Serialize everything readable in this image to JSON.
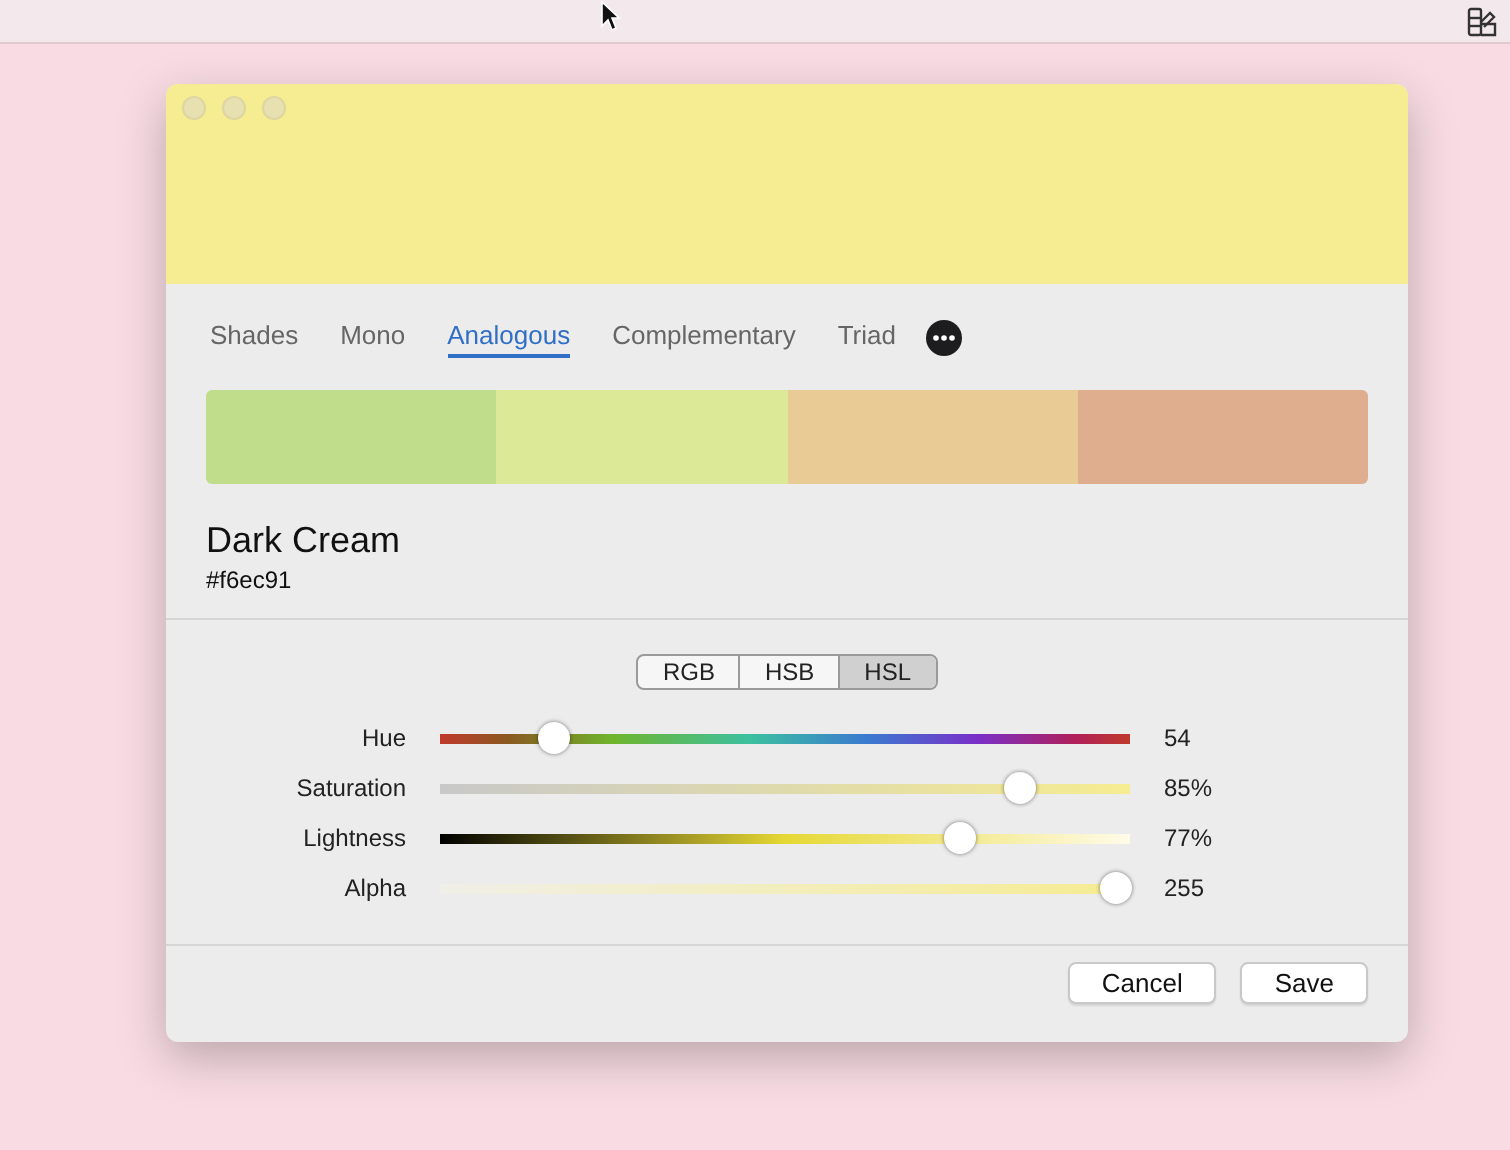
{
  "tabs": [
    {
      "label": "Shades",
      "selected": false
    },
    {
      "label": "Mono",
      "selected": false
    },
    {
      "label": "Analogous",
      "selected": true
    },
    {
      "label": "Complementary",
      "selected": false
    },
    {
      "label": "Triad",
      "selected": false
    }
  ],
  "swatches": [
    {
      "color": "#c0dd8c"
    },
    {
      "color": "#dcea97"
    },
    {
      "color": "#e8cb95"
    },
    {
      "color": "#deae8e"
    }
  ],
  "color_name": "Dark Cream",
  "color_hex": "#f6ec91",
  "modes": [
    {
      "label": "RGB",
      "selected": false
    },
    {
      "label": "HSB",
      "selected": false
    },
    {
      "label": "HSL",
      "selected": true
    }
  ],
  "sliders": [
    {
      "kind": "hue",
      "label": "Hue",
      "level": 0.165,
      "reading": "54"
    },
    {
      "kind": "saturation",
      "label": "Saturation",
      "level": 0.84,
      "reading": "85%"
    },
    {
      "kind": "lightness",
      "label": "Lightness",
      "level": 0.755,
      "reading": "77%"
    },
    {
      "kind": "alpha",
      "label": "Alpha",
      "level": 0.98,
      "reading": "255"
    }
  ],
  "buttons": [
    {
      "label": "Cancel"
    },
    {
      "label": "Save"
    }
  ]
}
